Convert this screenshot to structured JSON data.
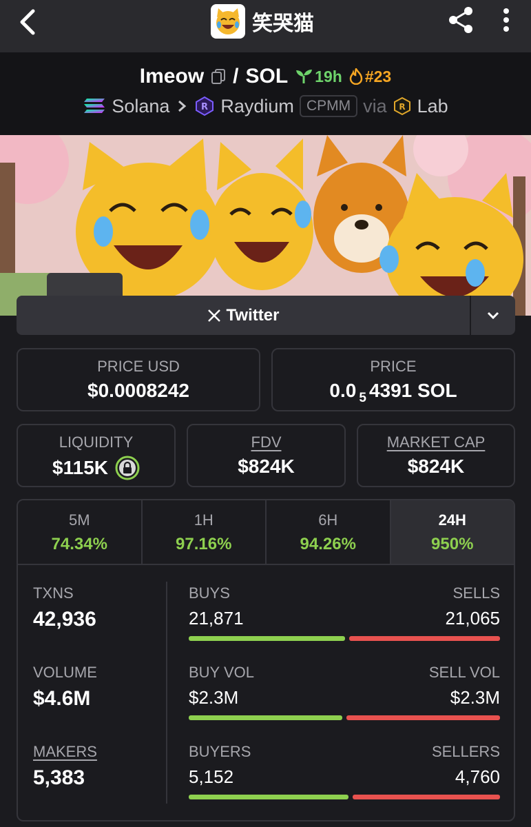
{
  "app": {
    "title": "笑哭猫"
  },
  "pair": {
    "base": "Imeow",
    "separator": "/",
    "quote": "SOL",
    "age": "19h",
    "rank": "#23",
    "chain": "Solana",
    "dex": "Raydium",
    "pool_type": "CPMM",
    "via": "via",
    "launchpad": "Lab"
  },
  "social": {
    "twitter_label": "Twitter"
  },
  "prices": {
    "price_usd_label": "PRICE USD",
    "price_usd": "$0.0008242",
    "price_label": "PRICE",
    "price_sol_prefix": "0.0",
    "price_sol_zeros": "5",
    "price_sol_digits": "4391 SOL"
  },
  "metrics": {
    "liquidity_label": "LIQUIDITY",
    "liquidity": "$115K",
    "fdv_label": "FDV",
    "fdv": "$824K",
    "mcap_label": "MARKET CAP",
    "mcap": "$824K"
  },
  "timeframes": [
    {
      "label": "5M",
      "change": "74.34%"
    },
    {
      "label": "1H",
      "change": "97.16%"
    },
    {
      "label": "6H",
      "change": "94.26%"
    },
    {
      "label": "24H",
      "change": "950%"
    }
  ],
  "stats": {
    "txns_label": "TXNS",
    "txns": "42,936",
    "volume_label": "VOLUME",
    "volume": "$4.6M",
    "makers_label": "MAKERS",
    "makers": "5,383",
    "buys_label": "BUYS",
    "buys": "21,871",
    "sells_label": "SELLS",
    "sells": "21,065",
    "buy_vol_label": "BUY VOL",
    "buy_vol": "$2.3M",
    "sell_vol_label": "SELL VOL",
    "sell_vol": "$2.3M",
    "buyers_label": "BUYERS",
    "buyers": "5,152",
    "sellers_label": "SELLERS",
    "sellers": "4,760"
  },
  "ratios": {
    "txns_buy_fraction": 0.509,
    "volume_buy_fraction": 0.5,
    "makers_buy_fraction": 0.52
  },
  "colors": {
    "positive": "#8ed04f",
    "negative": "#e8524f",
    "age": "#6ed36b",
    "rank": "#f6a623"
  }
}
